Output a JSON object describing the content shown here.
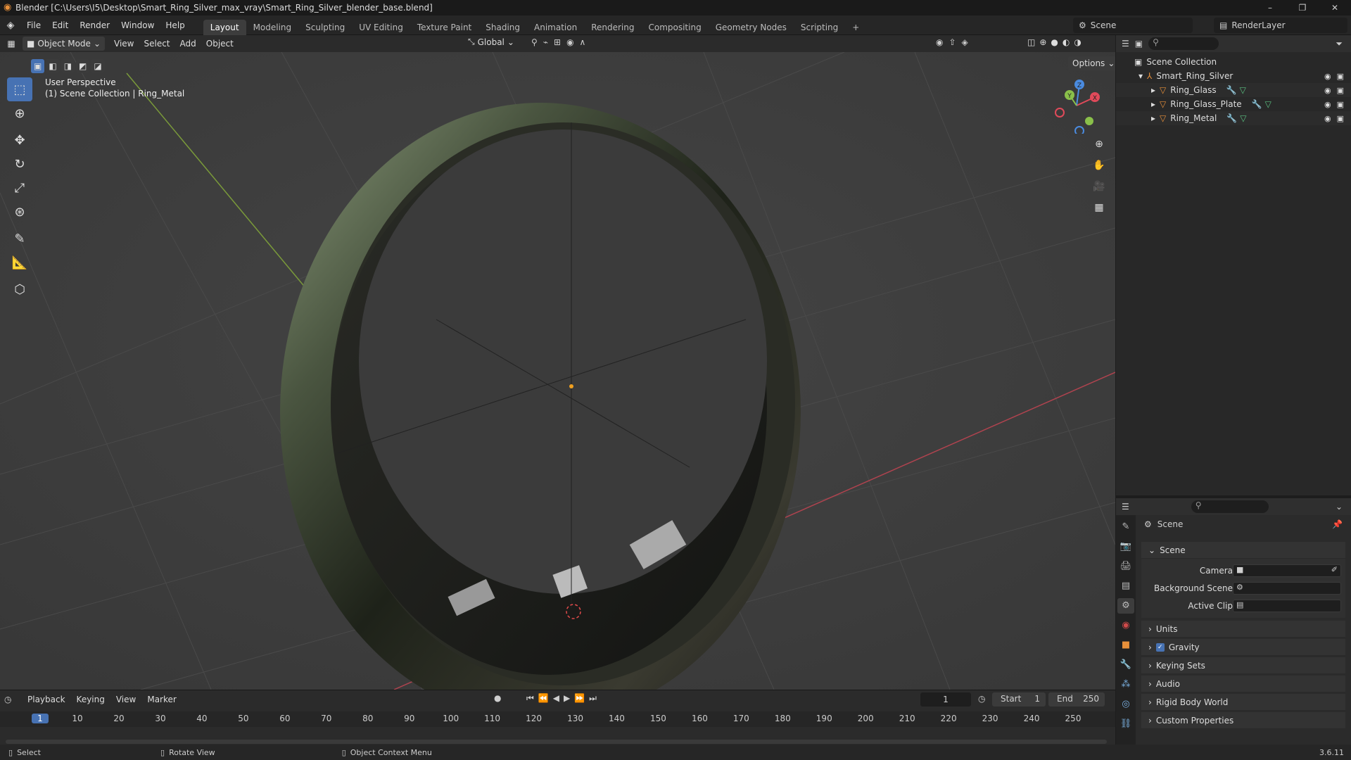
{
  "window": {
    "title": "Blender [C:\\Users\\I5\\Desktop\\Smart_Ring_Silver_max_vray\\Smart_Ring_Silver_blender_base.blend]",
    "minimize": "–",
    "maximize": "❐",
    "close": "✕"
  },
  "menu": [
    "File",
    "Edit",
    "Render",
    "Window",
    "Help"
  ],
  "workspaces": [
    "Layout",
    "Modeling",
    "Sculpting",
    "UV Editing",
    "Texture Paint",
    "Shading",
    "Animation",
    "Rendering",
    "Compositing",
    "Geometry Nodes",
    "Scripting"
  ],
  "active_workspace": "Layout",
  "add_workspace": "+",
  "scene_selector": {
    "value": "Scene"
  },
  "layer_selector": {
    "value": "RenderLayer"
  },
  "viewport_header": {
    "mode": "Object Mode",
    "menus": [
      "View",
      "Select",
      "Add",
      "Object"
    ],
    "orientation": "Global",
    "options": "Options"
  },
  "viewport": {
    "perspective_label": "User Perspective",
    "collection_label": "(1) Scene Collection | Ring_Metal",
    "gizmo": {
      "x": "X",
      "y": "Y",
      "z": "Z"
    }
  },
  "outliner": {
    "root": "Scene Collection",
    "collection": "Smart_Ring_Silver",
    "objects": [
      "Ring_Glass",
      "Ring_Glass_Plate",
      "Ring_Metal"
    ]
  },
  "properties": {
    "context": "Scene",
    "panel_scene": "Scene",
    "camera_label": "Camera",
    "background_label": "Background Scene",
    "clip_label": "Active Clip",
    "sections": [
      "Units",
      "Gravity",
      "Keying Sets",
      "Audio",
      "Rigid Body World",
      "Custom Properties"
    ],
    "gravity_checked": true
  },
  "timeline": {
    "menus": [
      "Playback",
      "Keying",
      "View",
      "Marker"
    ],
    "current_frame": "1",
    "start_label": "Start",
    "start_value": "1",
    "end_label": "End",
    "end_value": "250",
    "ticks": [
      "1",
      "10",
      "20",
      "30",
      "40",
      "50",
      "60",
      "70",
      "80",
      "90",
      "100",
      "110",
      "120",
      "130",
      "140",
      "150",
      "160",
      "170",
      "180",
      "190",
      "200",
      "210",
      "220",
      "230",
      "240",
      "250"
    ]
  },
  "statusbar": {
    "select": "Select",
    "rotate": "Rotate View",
    "context_menu": "Object Context Menu",
    "version": "3.6.11"
  },
  "colors": {
    "accent": "#4772b3",
    "x_axis": "#e04a5a",
    "y_axis": "#8ac04a",
    "z_axis": "#4a8be0",
    "object_orange": "#e8903a"
  }
}
